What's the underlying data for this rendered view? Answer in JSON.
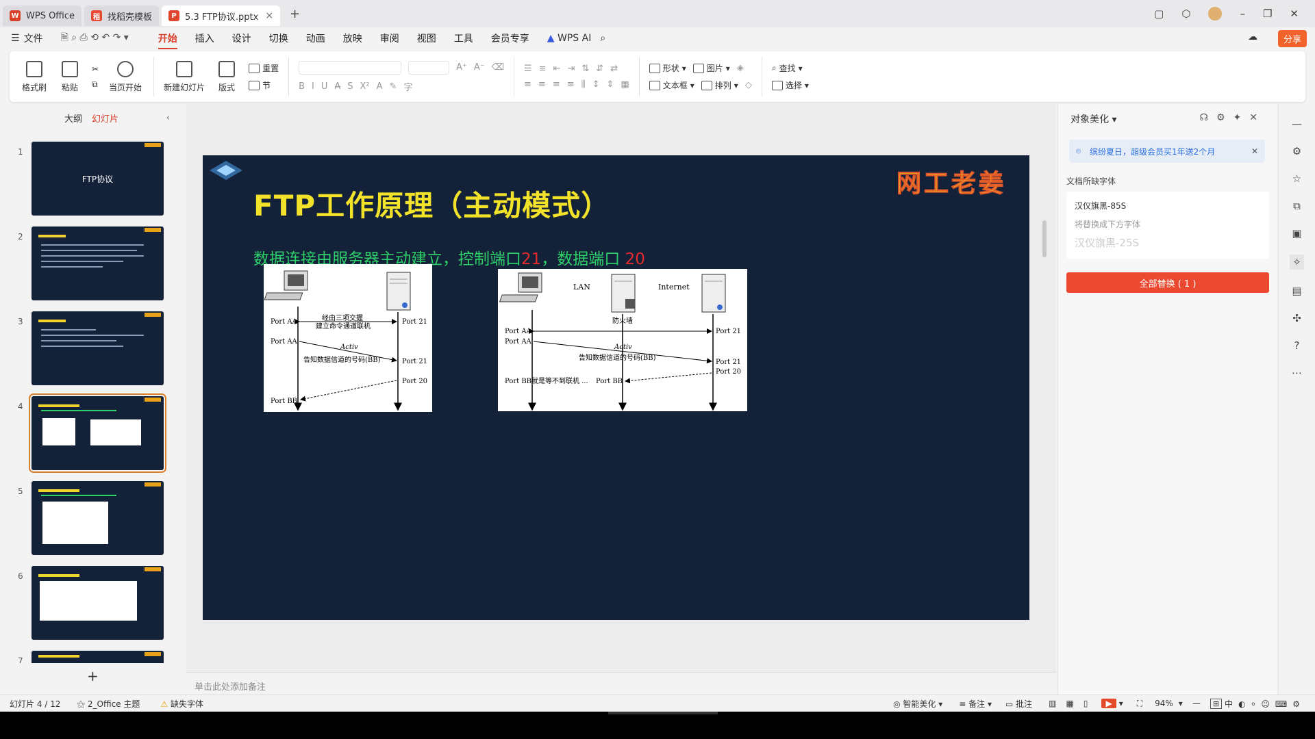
{
  "titlebar": {
    "tabs": [
      {
        "label": "WPS Office",
        "logo": "W",
        "color": "#d9402b"
      },
      {
        "label": "找稻壳模板",
        "logo": "稻",
        "color": "#e8492f"
      },
      {
        "label": "5.3 FTP协议.pptx",
        "logo": "P",
        "color": "#e0462d"
      }
    ]
  },
  "menubar": {
    "file": "文件",
    "items": [
      "开始",
      "插入",
      "设计",
      "切换",
      "动画",
      "放映",
      "审阅",
      "视图",
      "工具",
      "会员专享"
    ],
    "ai": "WPS AI",
    "share": "分享"
  },
  "ribbon": {
    "format_painter": "格式刷",
    "paste": "粘贴",
    "from_current": "当页开始",
    "new_slide": "新建幻灯片",
    "layout": "版式",
    "section": "节",
    "reset": "重置",
    "shape": "形状",
    "picture": "图片",
    "textbox": "文本框",
    "arrange": "排列",
    "find": "查找",
    "select": "选择"
  },
  "leftpanel": {
    "tab_outline": "大纲",
    "tab_slides": "幻灯片",
    "slides": [
      {
        "num": "1",
        "title": "FTP协议"
      },
      {
        "num": "2"
      },
      {
        "num": "3"
      },
      {
        "num": "4"
      },
      {
        "num": "5"
      },
      {
        "num": "6"
      },
      {
        "num": "7"
      }
    ],
    "selected": 4
  },
  "slide": {
    "title": "FTP工作原理（主动模式）",
    "sub_a": "数据连接由服务器主动建立，控制端口",
    "sub_b": "21",
    "sub_c": "，数据端口 ",
    "sub_d": "20",
    "watermark": "网工老姜",
    "diagram1": {
      "port_aa1": "Port AA",
      "port_aa2": "Port AA",
      "port_21a": "Port 21",
      "port_21b": "Port 21",
      "port_20": "Port 20",
      "port_bb": "Port BB",
      "msg1a": "经由三项交握",
      "msg1b": "建立命令通道联机",
      "activ": "Activ",
      "msg2": "告知数据信道的号码(BB)"
    },
    "diagram2": {
      "lan": "LAN",
      "internet": "Internet",
      "firewall": "防火墙",
      "port_aa1": "Port AA",
      "port_aa2": "Port AA",
      "port_21a": "Port 21",
      "port_21b": "Port 21",
      "port_20": "Port 20",
      "port_bb_wait": "Port BB就是等不到联机 ...",
      "port_bb": "Port BB",
      "activ": "Activ",
      "msg2": "告知数据信道的号码(BB)"
    }
  },
  "notes_placeholder": "单击此处添加备注",
  "rightpane": {
    "title": "对象美化",
    "banner": "缤纷夏日，超级会员买1年送2个月",
    "missing_label": "文档所缺字体",
    "font_name": "汉仪旗黑-85S",
    "replace_hint": "将替换成下方字体",
    "replacement": "汉仪旗黑-25S",
    "replace_all": "全部替换 ( 1 )"
  },
  "status": {
    "slide_count": "幻灯片 4 / 12",
    "theme": "2_Office 主题",
    "missing_font": "缺失字体",
    "beautify": "智能美化",
    "notes": "备注",
    "comments": "批注",
    "zoom": "94%",
    "ime": "中"
  }
}
